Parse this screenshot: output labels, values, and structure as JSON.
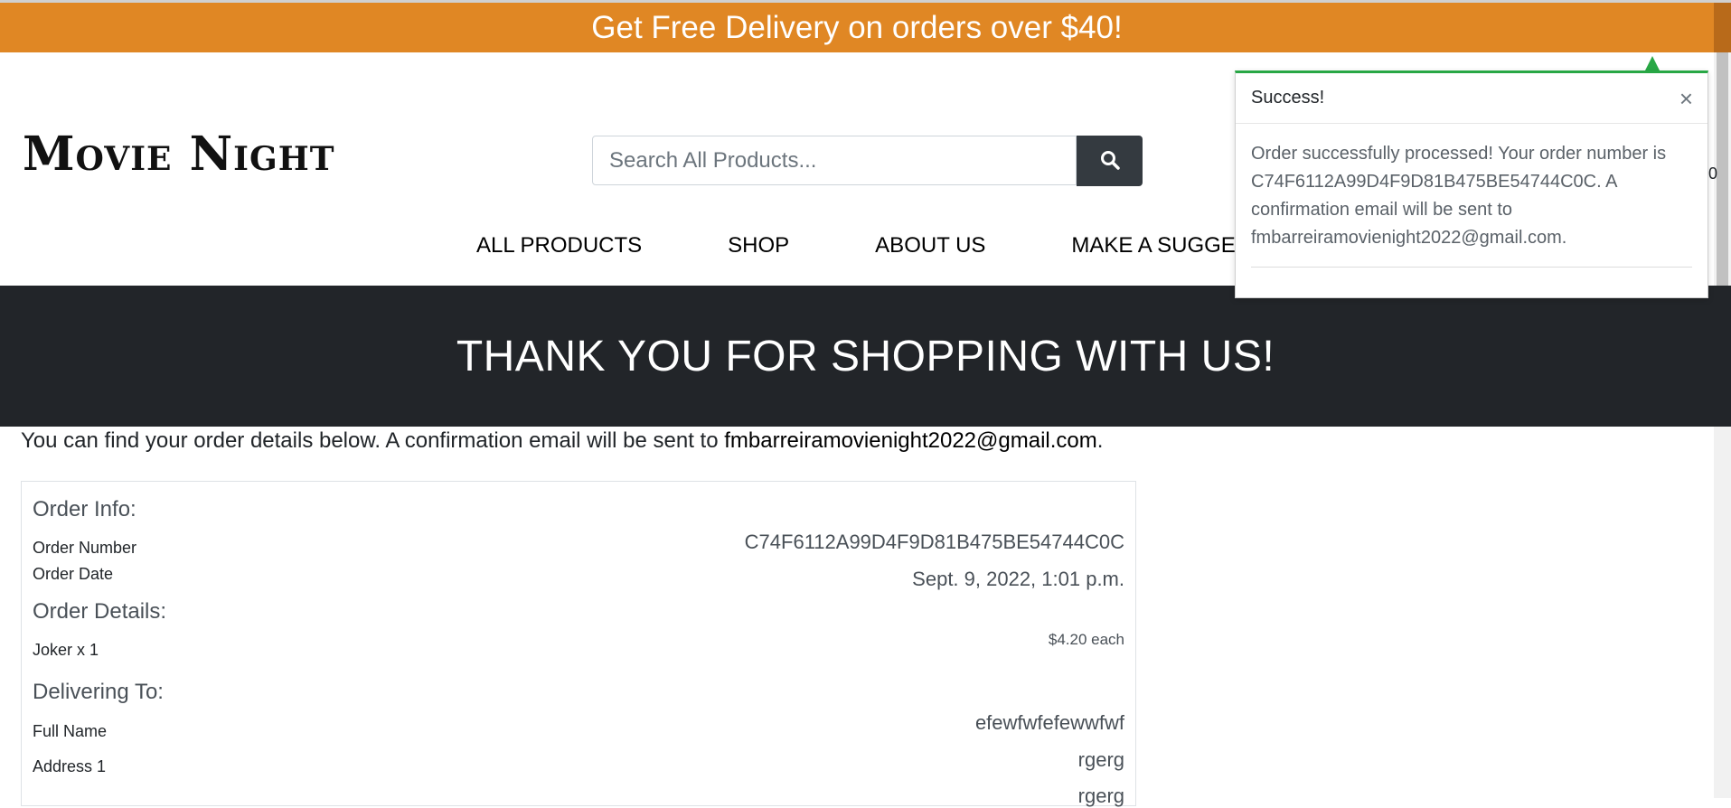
{
  "banner": {
    "text": "Get Free Delivery on orders over $40!"
  },
  "header": {
    "logo": "Movie Night",
    "search_placeholder": "Search All Products..."
  },
  "nav": {
    "items": [
      "ALL PRODUCTS",
      "SHOP",
      "ABOUT US",
      "MAKE A SUGGESTIC"
    ]
  },
  "hero": {
    "title": "THANK YOU FOR SHOPPING WITH US!"
  },
  "intro": {
    "text": "You can find your order details below. A confirmation email will be sent to ",
    "email": "fmbarreiramovienight2022@gmail.com",
    "end": "."
  },
  "order": {
    "info_title": "Order Info:",
    "number_label": "Order Number",
    "number_value": "C74F6112A99D4F9D81B475BE54744C0C",
    "date_label": "Order Date",
    "date_value": "Sept. 9, 2022, 1:01 p.m.",
    "details_title": "Order Details:",
    "item_label": "Joker x 1",
    "item_price": "$4.20 each",
    "delivery_title": "Delivering To:",
    "full_name_label": "Full Name",
    "full_name_value": "efewfwfefewwfwf",
    "address1_label": "Address 1",
    "address1_value": "rgerg",
    "address2_value": "rgerg"
  },
  "toast": {
    "title": "Success!",
    "close": "×",
    "body": "Order successfully processed! Your order number is C74F6112A99D4F9D81B475BE54744C0C. A confirmation email will be sent to fmbarreiramovienight2022@gmail.com."
  },
  "cart_peek": "0",
  "colors": {
    "banner": "#e08724",
    "hero": "#222529",
    "toast_accent": "#28a745",
    "search_button": "#343a40"
  },
  "icons": {
    "search": "search-icon",
    "close": "close-icon"
  }
}
